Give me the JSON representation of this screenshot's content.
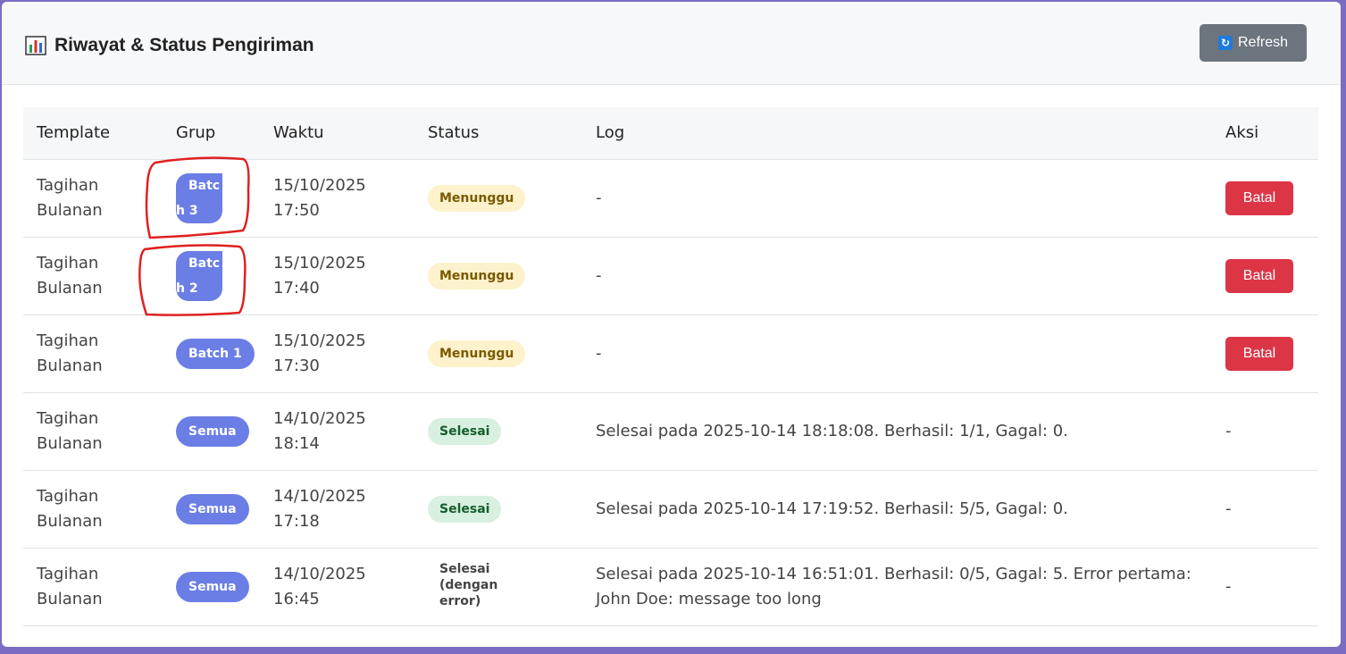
{
  "header": {
    "title": "Riwayat & Status Pengiriman",
    "refresh_label": "Refresh"
  },
  "table": {
    "columns": [
      "Template",
      "Grup",
      "Waktu",
      "Status",
      "Log",
      "Aksi"
    ],
    "rows": [
      {
        "template": "Tagihan Bulanan",
        "group": "Batch 3",
        "time_date": "15/10/2025",
        "time_clock": "17:50",
        "status": "Menunggu",
        "log": "-",
        "action": "Batal"
      },
      {
        "template": "Tagihan Bulanan",
        "group": "Batch 2",
        "time_date": "15/10/2025",
        "time_clock": "17:40",
        "status": "Menunggu",
        "log": "-",
        "action": "Batal"
      },
      {
        "template": "Tagihan Bulanan",
        "group": "Batch 1",
        "time_date": "15/10/2025",
        "time_clock": "17:30",
        "status": "Menunggu",
        "log": "-",
        "action": "Batal"
      },
      {
        "template": "Tagihan Bulanan",
        "group": "Semua",
        "time_date": "14/10/2025",
        "time_clock": "18:14",
        "status": "Selesai",
        "log": "Selesai pada 2025-10-14 18:18:08. Berhasil: 1/1, Gagal: 0.",
        "action": "-"
      },
      {
        "template": "Tagihan Bulanan",
        "group": "Semua",
        "time_date": "14/10/2025",
        "time_clock": "17:18",
        "status": "Selesai",
        "log": "Selesai pada 2025-10-14 17:19:52. Berhasil: 5/5, Gagal: 0.",
        "action": "-"
      },
      {
        "template": "Tagihan Bulanan",
        "group": "Semua",
        "time_date": "14/10/2025",
        "time_clock": "16:45",
        "status": "Selesai (dengan error)",
        "log": "Selesai pada 2025-10-14 16:51:01. Berhasil: 0/5, Gagal: 5. Error pertama: John Doe: message too long",
        "action": "-"
      }
    ]
  },
  "colors": {
    "badge": "#6b7ee6",
    "waiting_bg": "#fdf2cc",
    "done_bg": "#d8f0df",
    "cancel_button": "#dc3545",
    "refresh_button": "#6c757d",
    "annotation": "#e02020"
  }
}
